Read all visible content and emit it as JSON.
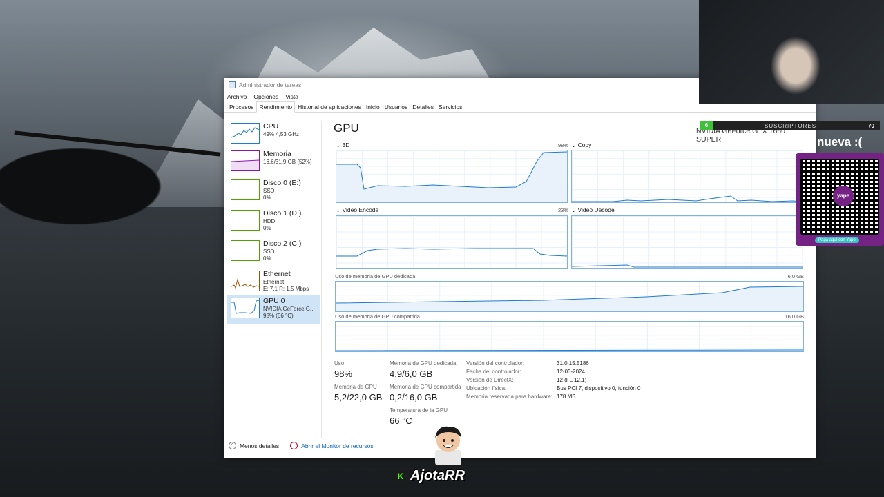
{
  "window": {
    "title": "Administrador de tareas"
  },
  "menu": [
    "Archivo",
    "Opciones",
    "Vista"
  ],
  "tabs": [
    "Procesos",
    "Rendimiento",
    "Historial de aplicaciones",
    "Inicio",
    "Usuarios",
    "Detalles",
    "Servicios"
  ],
  "sidebar": [
    {
      "name": "CPU",
      "sub1": "49% 4,53 GHz",
      "sub2": ""
    },
    {
      "name": "Memoria",
      "sub1": "16,6/31,9 GB (52%)",
      "sub2": ""
    },
    {
      "name": "Disco 0 (E:)",
      "sub1": "SSD",
      "sub2": "0%"
    },
    {
      "name": "Disco 1 (D:)",
      "sub1": "HDD",
      "sub2": "0%"
    },
    {
      "name": "Disco 2 (C:)",
      "sub1": "SSD",
      "sub2": "0%"
    },
    {
      "name": "Ethernet",
      "sub1": "Ethernet",
      "sub2": "E: 7,1 R: 1,5 Mbps"
    },
    {
      "name": "GPU 0",
      "sub1": "NVIDIA GeForce G...",
      "sub2": "98% (66 °C)"
    }
  ],
  "gpu": {
    "title": "GPU",
    "model": "NVIDIA GeForce GTX 1660 SUPER",
    "graphs": {
      "g3d": {
        "label": "3D",
        "pct": "98%"
      },
      "copy": {
        "label": "Copy"
      },
      "encode": {
        "label": "Video Encode",
        "pct": "23%"
      },
      "decode": {
        "label": "Video Decode"
      }
    },
    "dedicated": {
      "label": "Uso de memoria de GPU dedicada",
      "max": "6,0 GB"
    },
    "shared": {
      "label": "Uso de memoria de GPU compartida",
      "max": "16,0 GB"
    },
    "stats": {
      "usage_label": "Uso",
      "usage": "98%",
      "mem_label": "Memoria de GPU",
      "mem": "5,2/22,0 GB",
      "ded_label": "Memoria de GPU dedicada",
      "ded": "4,9/6,0 GB",
      "shr_label": "Memoria de GPU compartida",
      "shr": "0,2/16,0 GB",
      "temp_label": "Temperatura de la GPU",
      "temp": "66 °C"
    },
    "props": [
      {
        "k": "Versión del controlador:",
        "v": "31.0.15.5186"
      },
      {
        "k": "Fecha del controlador:",
        "v": "12-03-2024"
      },
      {
        "k": "Versión de DirectX:",
        "v": "12 (FL 12.1)"
      },
      {
        "k": "Ubicación física:",
        "v": "Bus PCI 7, dispositivo 0, función 0"
      },
      {
        "k": "Memoria reservada para hardware:",
        "v": "178 MB"
      }
    ]
  },
  "footer": {
    "less": "Menos detalles",
    "monitor": "Abrir el Monitor de recursos"
  },
  "overlay": {
    "subs_goal": "6",
    "subs_label": "SUSCRIPTORES",
    "subs_target": "70",
    "nueva": "nueva :(",
    "yape_logo": "yape",
    "yape_btn": "Paga aquí con Yape",
    "brand_icon": "K",
    "brand": "AjotaRR"
  },
  "colors": {
    "gpu_line": "#1e7bd2",
    "memory": "#8b18ad",
    "disk": "#4fa300",
    "ethernet": "#a74f01",
    "yape": "#742284"
  },
  "icons": [
    "task-manager-icon",
    "chevron-up-icon",
    "resource-monitor-icon",
    "kick-icon",
    "qr-code-icon"
  ]
}
